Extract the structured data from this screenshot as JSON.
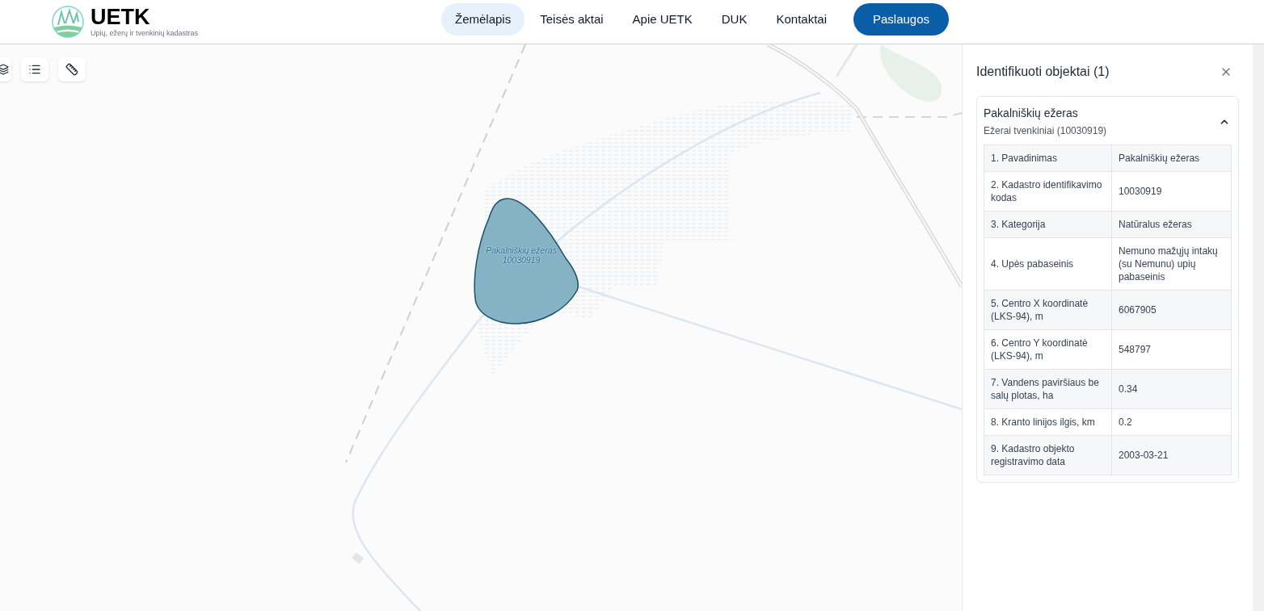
{
  "header": {
    "logo_title": "UETK",
    "logo_subtitle": "Upių, ežerų ir tvenkinių kadastras",
    "nav": [
      {
        "label": "Žemėlapis",
        "selected": true
      },
      {
        "label": "Teisės aktai",
        "selected": false
      },
      {
        "label": "Apie UETK",
        "selected": false
      },
      {
        "label": "DUK",
        "selected": false
      },
      {
        "label": "Kontaktai",
        "selected": false
      }
    ],
    "cta_button": "Paslaugos"
  },
  "map": {
    "feature_label": [
      "Pakalniškių ežeras",
      "10030919"
    ]
  },
  "panel": {
    "title": "Identifikuoti objektai (1)",
    "result": {
      "name": "Pakalniškių ežeras",
      "subtitle": "Ežerai tvenkiniai (10030919)",
      "expanded": true,
      "rows": [
        {
          "label": "1. Pavadinimas",
          "value": "Pakalniškių ežeras"
        },
        {
          "label": "2. Kadastro identifikavimo kodas",
          "value": "10030919"
        },
        {
          "label": "3. Kategorija",
          "value": "Natūralus ežeras"
        },
        {
          "label": "4. Upės pabaseinis",
          "value": "Nemuno mažųjų intakų (su Nemunu) upių pabaseinis"
        },
        {
          "label": "5. Centro X koordinatė (LKS-94), m",
          "value": "6067905"
        },
        {
          "label": "6. Centro Y koordinatė (LKS-94), m",
          "value": "548797"
        },
        {
          "label": "7. Vandens paviršiaus be salų plotas, ha",
          "value": "0.34"
        },
        {
          "label": "8. Kranto linijos ilgis, km",
          "value": "0.2"
        },
        {
          "label": "9. Kadastro objekto registravimo data",
          "value": "2003-03-21"
        }
      ]
    }
  }
}
